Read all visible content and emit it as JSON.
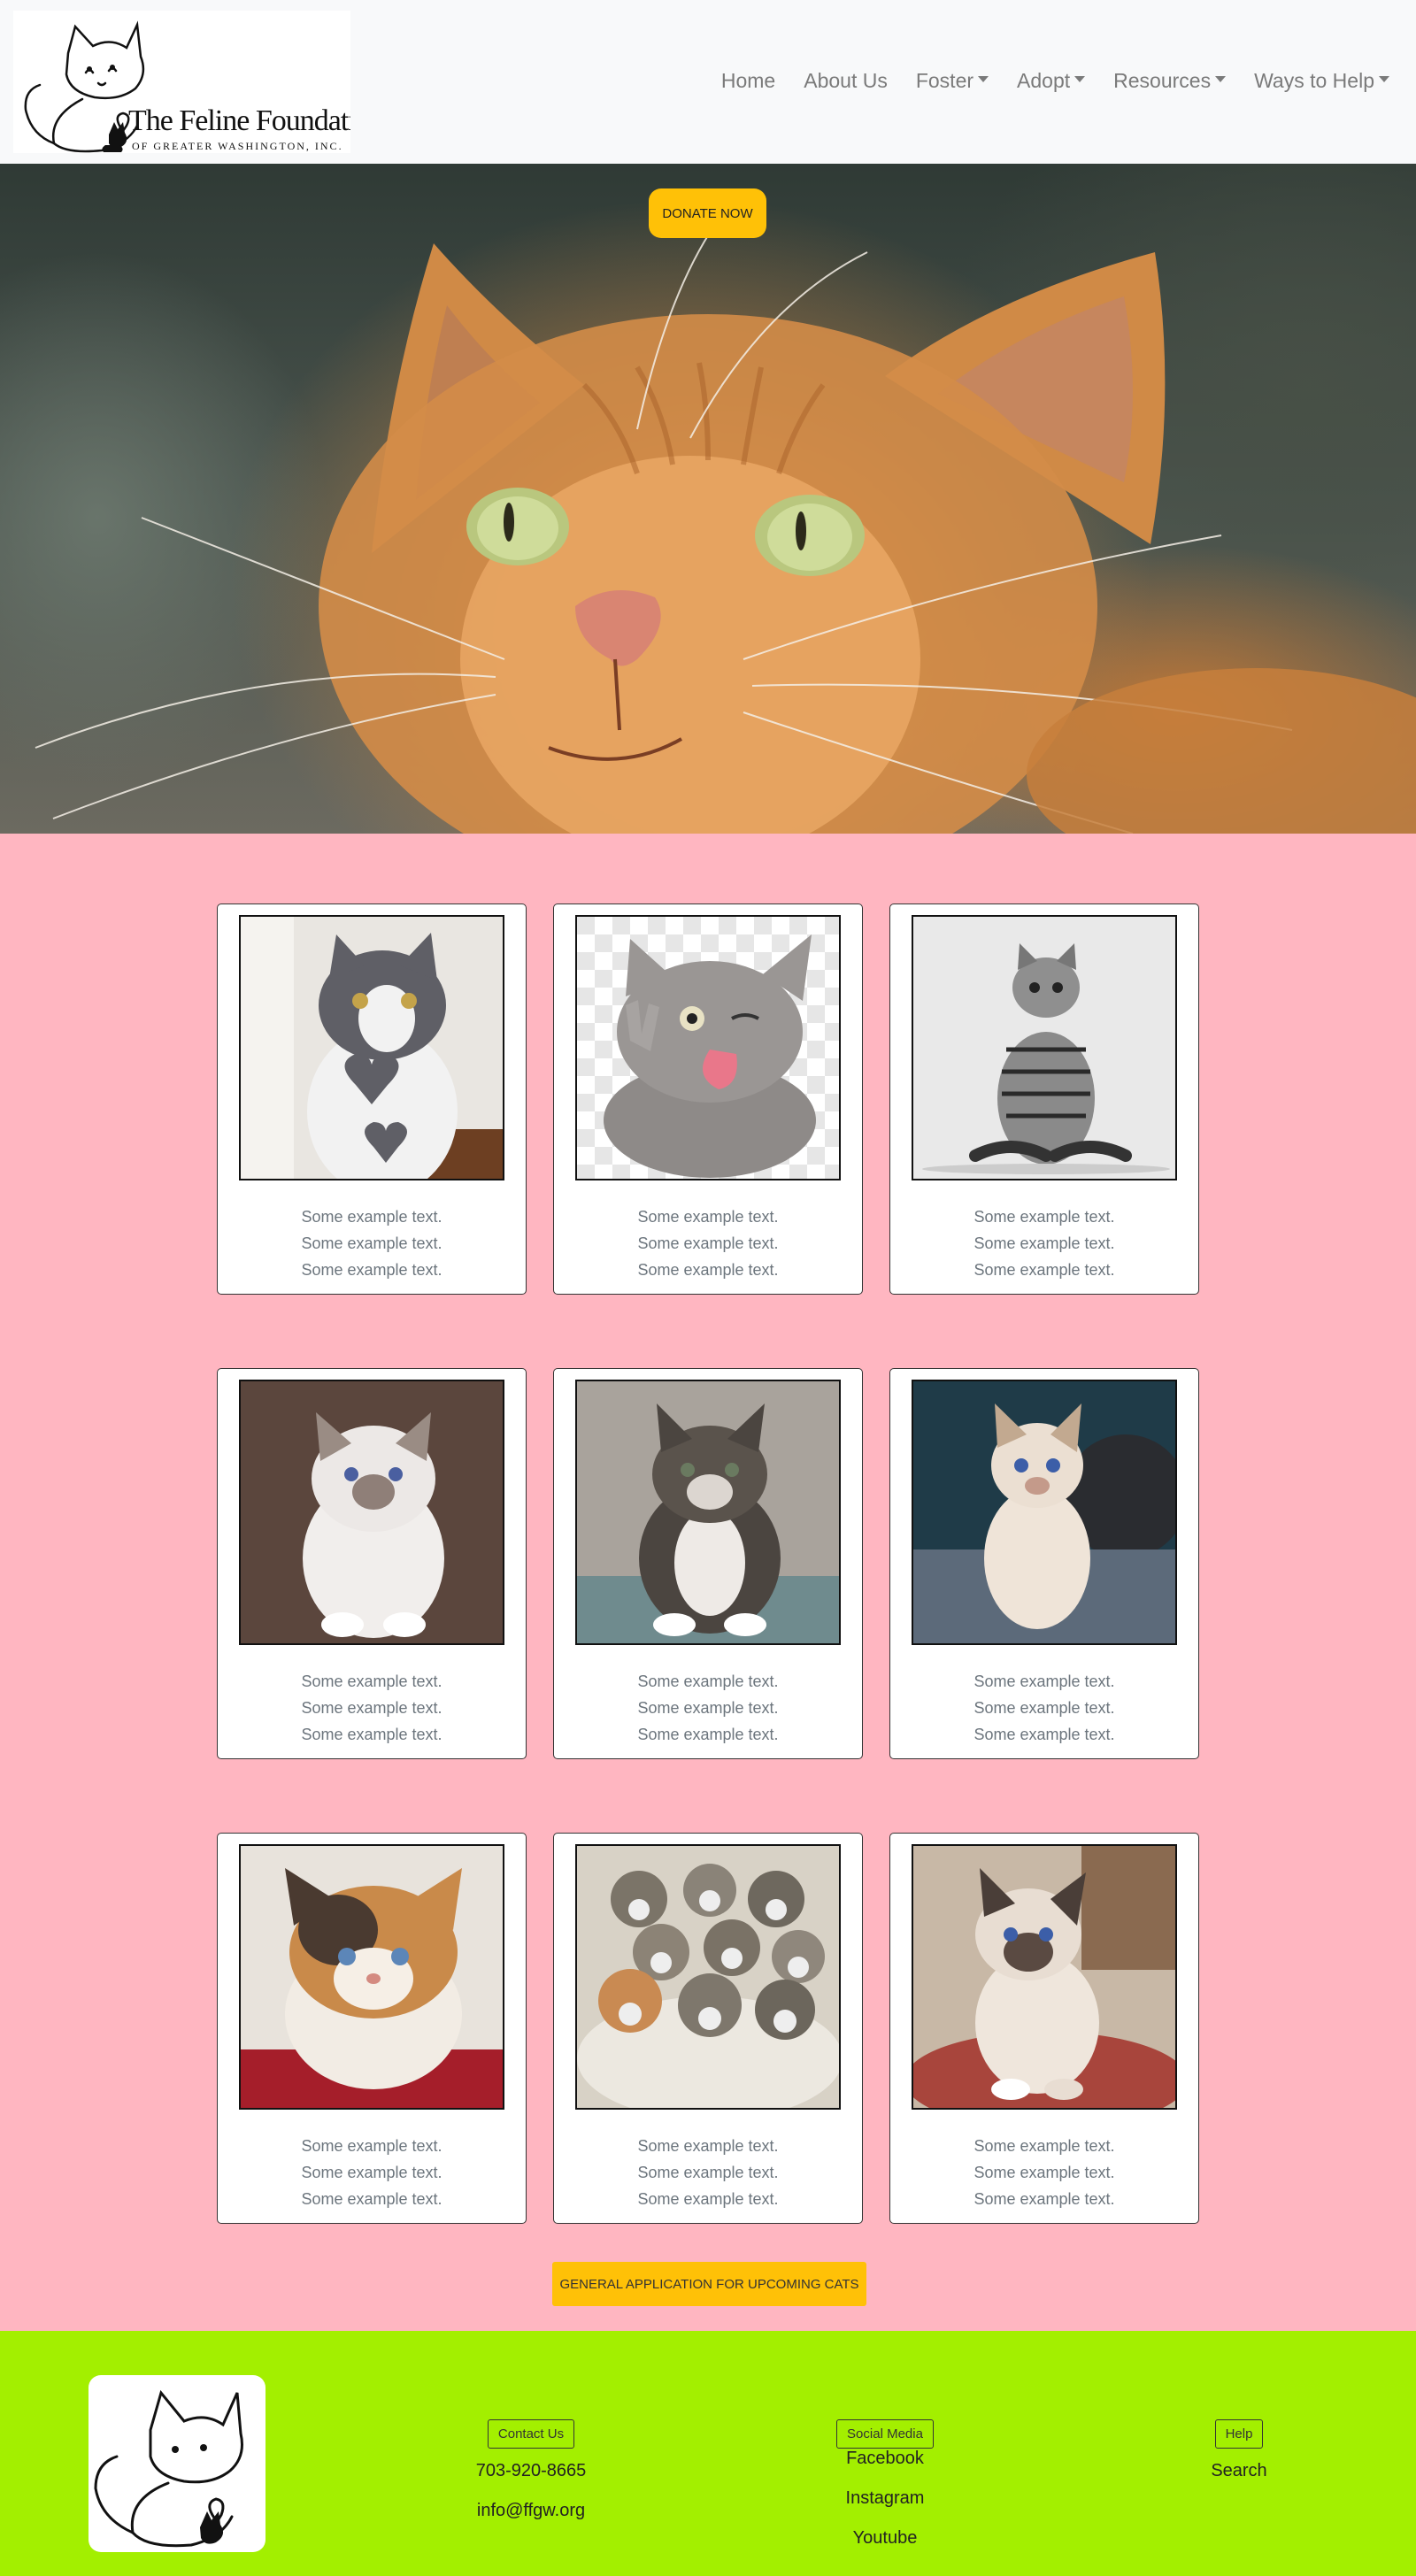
{
  "logo": {
    "title": "The Feline Foundation",
    "subtitle": "OF GREATER WASHINGTON, INC."
  },
  "nav": [
    {
      "label": "Home",
      "dropdown": false
    },
    {
      "label": "About Us",
      "dropdown": false
    },
    {
      "label": "Foster",
      "dropdown": true
    },
    {
      "label": "Adopt",
      "dropdown": true
    },
    {
      "label": "Resources",
      "dropdown": true
    },
    {
      "label": "Ways to Help",
      "dropdown": true
    }
  ],
  "hero": {
    "donate_label": "DONATE NOW"
  },
  "cards": [
    {
      "lines": [
        "Some example text.",
        "Some example text.",
        "Some example text."
      ]
    },
    {
      "lines": [
        "Some example text.",
        "Some example text.",
        "Some example text."
      ]
    },
    {
      "lines": [
        "Some example text.",
        "Some example text.",
        "Some example text."
      ]
    },
    {
      "lines": [
        "Some example text.",
        "Some example text.",
        "Some example text."
      ]
    },
    {
      "lines": [
        "Some example text.",
        "Some example text.",
        "Some example text."
      ]
    },
    {
      "lines": [
        "Some example text.",
        "Some example text.",
        "Some example text."
      ]
    },
    {
      "lines": [
        "Some example text.",
        "Some example text.",
        "Some example text."
      ]
    },
    {
      "lines": [
        "Some example text.",
        "Some example text.",
        "Some example text."
      ]
    },
    {
      "lines": [
        "Some example text.",
        "Some example text.",
        "Some example text."
      ]
    }
  ],
  "application_button": "GENERAL APPLICATION FOR UPCOMING CATS",
  "footer": {
    "contact": {
      "button": "Contact Us",
      "phone": "703-920-8665",
      "email": "info@ffgw.org"
    },
    "social": {
      "button": "Social Media",
      "links": [
        "Facebook",
        "Instagram",
        "Youtube"
      ]
    },
    "help": {
      "button": "Help",
      "search": "Search"
    }
  },
  "colors": {
    "navbar_bg": "#f8f9fa",
    "page_bg": "#ffb6c1",
    "footer_bg": "#a3ef00",
    "accent": "#ffc107"
  }
}
